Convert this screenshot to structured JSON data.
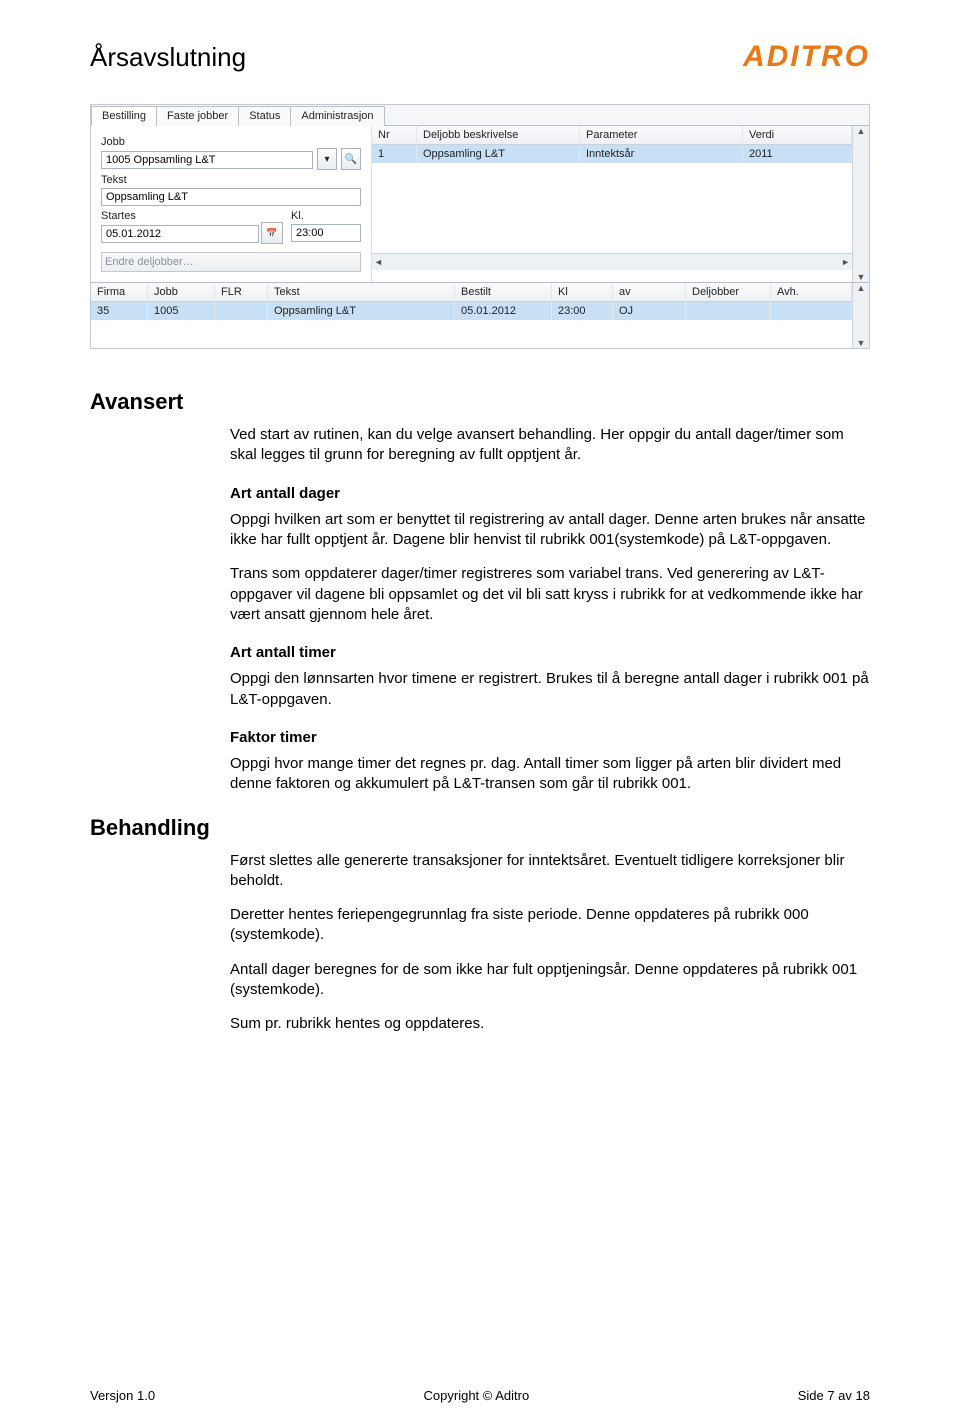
{
  "header": {
    "doc_title": "Årsavslutning",
    "logo_text": "ADITRO"
  },
  "app": {
    "tabs": [
      "Bestilling",
      "Faste jobber",
      "Status",
      "Administrasjon"
    ],
    "active_tab_index": 0,
    "left": {
      "jobb_label": "Jobb",
      "jobb_value": "1005 Oppsamling L&T",
      "tekst_label": "Tekst",
      "tekst_value": "Oppsamling L&T",
      "startes_label": "Startes",
      "startes_value": "05.01.2012",
      "kl_label": "Kl.",
      "kl_value": "23:00",
      "endre_label": "Endre deljobber…"
    },
    "right_grid": {
      "headers": [
        "Nr",
        "Deljobb beskrivelse",
        "Parameter",
        "Verdi"
      ],
      "rows": [
        {
          "nr": "1",
          "desc": "Oppsamling L&T",
          "param": "Inntektsår",
          "value": "2011"
        }
      ]
    },
    "bottom_grid": {
      "headers": [
        "Firma",
        "Jobb",
        "FLR",
        "Tekst",
        "Bestilt",
        "Kl",
        "av",
        "Deljobber",
        "Avh."
      ],
      "rows": [
        {
          "firma": "35",
          "jobb": "1005",
          "flr": "",
          "tekst": "Oppsamling L&T",
          "bestilt": "05.01.2012",
          "kl": "23:00",
          "av": "OJ",
          "delj": "",
          "avh": ""
        }
      ]
    }
  },
  "sections": {
    "avansert": {
      "heading": "Avansert",
      "p1": "Ved start av rutinen, kan du velge avansert behandling. Her oppgir du antall dager/timer som skal legges til grunn for beregning av fullt opptjent år.",
      "sub1": "Art antall dager",
      "p2": "Oppgi hvilken art som er benyttet til registrering av antall dager. Denne arten brukes når ansatte ikke har fullt opptjent år. Dagene blir henvist til rubrikk 001(systemkode) på L&T-oppgaven.",
      "p3": "Trans som oppdaterer dager/timer registreres som variabel trans. Ved generering av L&T-oppgaver vil dagene bli oppsamlet og det vil bli satt kryss i rubrikk for at vedkommende ikke har vært ansatt gjennom hele året.",
      "sub2": "Art antall timer",
      "p4": "Oppgi den lønnsarten hvor timene er registrert. Brukes til å beregne antall dager i rubrikk 001 på L&T-oppgaven.",
      "sub3": "Faktor timer",
      "p5": "Oppgi hvor mange timer det regnes pr. dag. Antall timer som ligger på arten blir dividert med denne faktoren og akkumulert på L&T-transen som går til rubrikk 001."
    },
    "behandling": {
      "heading": "Behandling",
      "p1": "Først slettes alle genererte transaksjoner for inntektsåret. Eventuelt tidligere korreksjoner blir beholdt.",
      "p2": "Deretter hentes feriepengegrunnlag fra siste periode.  Denne oppdateres på rubrikk 000 (systemkode).",
      "p3": "Antall dager beregnes for de som ikke har fult opptjeningsår. Denne oppdateres på rubrikk 001 (systemkode).",
      "p4": "Sum pr. rubrikk hentes og oppdateres."
    }
  },
  "footer": {
    "left": "Versjon 1.0",
    "center": "Copyright © Aditro",
    "right": "Side 7 av 18"
  }
}
